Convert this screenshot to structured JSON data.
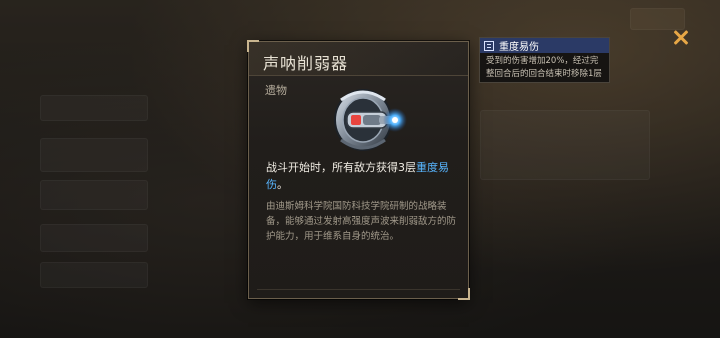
{
  "relic_card": {
    "title": "声呐削弱器",
    "type": "遗物",
    "effect_prefix": "战斗开始时，所有敌方获得3层",
    "effect_keyword": "重度易伤",
    "effect_suffix": "。",
    "lore": "由迪斯姆科学院国防科技学院研制的战略装备，能够通过发射高强度声波来削弱敌方的防护能力，用于维系自身的统治。"
  },
  "status_tooltip": {
    "icon": "status-document-icon",
    "title": "重度易伤",
    "description": "受到的伤害增加20%，经过完整回合后的回合结束时移除1层"
  },
  "colors": {
    "highlight": "#58b6ff",
    "close_accent": "#e7a746",
    "tooltip_header": "#2b3a66"
  },
  "icons": {
    "close": "close-icon",
    "relic": "sonar-device-icon"
  }
}
